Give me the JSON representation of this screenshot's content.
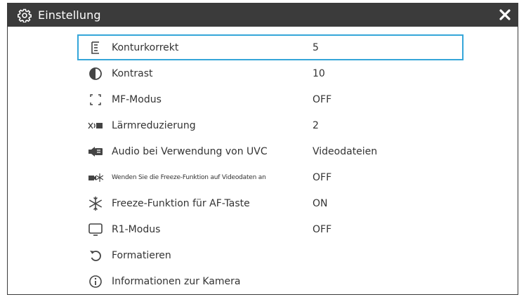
{
  "window": {
    "title": "Einstellung",
    "title_icon": "gear-icon",
    "close_icon": "close-icon"
  },
  "colors": {
    "titlebar": "#3b3b3b",
    "selection_border": "#35a6d9",
    "text": "#333333"
  },
  "settings": {
    "items": [
      {
        "label": "Konturkorrekt",
        "value": "5",
        "icon": "sharpness-icon",
        "selected": true
      },
      {
        "label": "Kontrast",
        "value": "10",
        "icon": "contrast-icon"
      },
      {
        "label": "MF-Modus",
        "value": "OFF",
        "icon": "focus-frame-icon"
      },
      {
        "label": "Lärmreduzierung",
        "value": "2",
        "icon": "noise-reduction-icon"
      },
      {
        "label": "Audio bei Verwendung von UVC",
        "value": "Videodateien",
        "icon": "uvc-audio-icon"
      },
      {
        "label": "Wenden Sie die Freeze-Funktion auf Videodaten an",
        "value": "OFF",
        "icon": "freeze-video-icon"
      },
      {
        "label": "Freeze-Funktion für AF-Taste",
        "value": "ON",
        "icon": "freeze-icon"
      },
      {
        "label": "R1-Modus",
        "value": "OFF",
        "icon": "monitor-icon"
      },
      {
        "label": "Formatieren",
        "value": "",
        "icon": "format-icon"
      },
      {
        "label": "Informationen zur Kamera",
        "value": "",
        "icon": "info-icon"
      }
    ]
  }
}
